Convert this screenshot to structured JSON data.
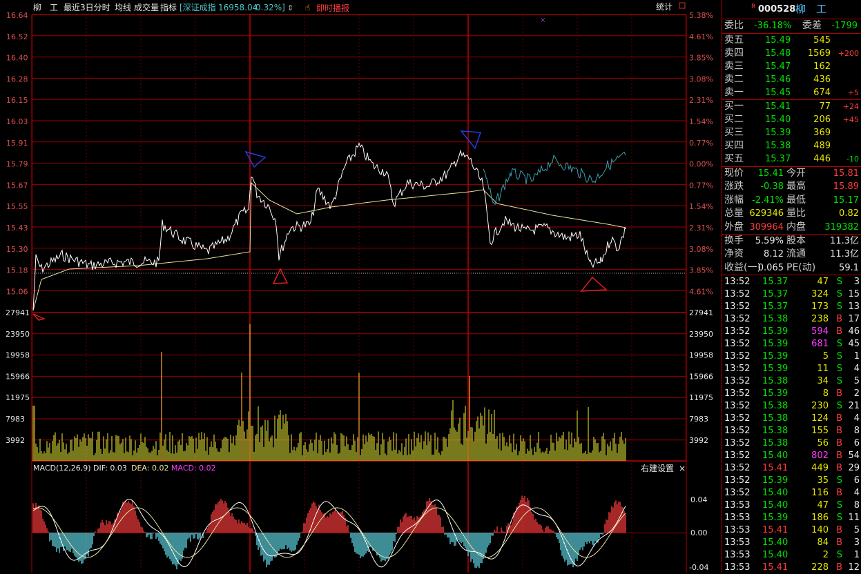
{
  "header": {
    "stock_name": "柳　工",
    "menu": [
      "最近3日分时",
      "均线",
      "成交量",
      "指标"
    ],
    "index_label": "[深证成指",
    "index_value": "16958.04",
    "index_change": "0.32%]",
    "live_label": "即时播报",
    "stats_label": "统计"
  },
  "price_axis": {
    "left": [
      "16.64",
      "16.52",
      "16.40",
      "16.28",
      "16.15",
      "16.03",
      "15.91",
      "15.79",
      "15.67",
      "15.55",
      "15.43",
      "15.30",
      "15.18",
      "15.06"
    ],
    "right": [
      "5.38%",
      "4.61%",
      "3.85%",
      "3.08%",
      "2.31%",
      "1.54%",
      "0.77%",
      "0.00%",
      "0.77%",
      "1.54%",
      "2.31%",
      "3.08%",
      "3.85%",
      "4.61%"
    ]
  },
  "volume_axis": [
    "27941",
    "23950",
    "19958",
    "15966",
    "11975",
    "7983",
    "3992"
  ],
  "macd": {
    "title": "MACD(12,26,9)",
    "dif_label": "DIF: 0.03",
    "dea_label": "DEA: 0.02",
    "macd_label": "MACD: 0.02",
    "right_label": "右建设置",
    "close": "×",
    "axis": [
      "0.04",
      "0.00",
      "-0.04"
    ]
  },
  "quote": {
    "badge": "R",
    "code": "000528",
    "name": "柳　工",
    "weibi_label": "委比",
    "weibi": "-36.18%",
    "weicha_label": "委差",
    "weicha": "-1799",
    "asks": [
      {
        "label": "卖五",
        "price": "15.49",
        "vol": "545",
        "chg": ""
      },
      {
        "label": "卖四",
        "price": "15.48",
        "vol": "1569",
        "chg": "+200"
      },
      {
        "label": "卖三",
        "price": "15.47",
        "vol": "162",
        "chg": ""
      },
      {
        "label": "卖二",
        "price": "15.46",
        "vol": "436",
        "chg": ""
      },
      {
        "label": "卖一",
        "price": "15.45",
        "vol": "674",
        "chg": "+5"
      }
    ],
    "bids": [
      {
        "label": "买一",
        "price": "15.41",
        "vol": "77",
        "chg": "+24"
      },
      {
        "label": "买二",
        "price": "15.40",
        "vol": "206",
        "chg": "+45"
      },
      {
        "label": "买三",
        "price": "15.39",
        "vol": "369",
        "chg": ""
      },
      {
        "label": "买四",
        "price": "15.38",
        "vol": "489",
        "chg": ""
      },
      {
        "label": "买五",
        "price": "15.37",
        "vol": "446",
        "chg": "-10"
      }
    ],
    "stats": [
      {
        "l1": "现价",
        "v1": "15.41",
        "c1": "grn",
        "l2": "今开",
        "v2": "15.81",
        "c2": "red"
      },
      {
        "l1": "涨跌",
        "v1": "-0.38",
        "c1": "grn",
        "l2": "最高",
        "v2": "15.89",
        "c2": "red"
      },
      {
        "l1": "涨幅",
        "v1": "-2.41%",
        "c1": "grn",
        "l2": "最低",
        "v2": "15.17",
        "c2": "grn"
      },
      {
        "l1": "总量",
        "v1": "629346",
        "c1": "yel",
        "l2": "量比",
        "v2": "0.82",
        "c2": "yel"
      },
      {
        "l1": "外盘",
        "v1": "309964",
        "c1": "red",
        "l2": "内盘",
        "v2": "319382",
        "c2": "grn"
      }
    ],
    "fund": [
      {
        "l1": "换手",
        "v1": "5.59%",
        "l2": "股本",
        "v2": "11.3亿"
      },
      {
        "l1": "净资",
        "v1": "8.12",
        "l2": "流通",
        "v2": "11.3亿"
      },
      {
        "l1": "收益(一)",
        "v1": "0.065",
        "l2": "PE(动)",
        "v2": "59.1"
      }
    ]
  },
  "trades": [
    {
      "t": "13:52",
      "p": "15.37",
      "v": "47",
      "s": "S",
      "n": "3",
      "vc": "yel"
    },
    {
      "t": "13:52",
      "p": "15.37",
      "v": "324",
      "s": "S",
      "n": "15",
      "vc": "yel"
    },
    {
      "t": "13:52",
      "p": "15.37",
      "v": "173",
      "s": "S",
      "n": "13",
      "vc": "yel"
    },
    {
      "t": "13:52",
      "p": "15.38",
      "v": "238",
      "s": "B",
      "n": "17",
      "vc": "yel"
    },
    {
      "t": "13:52",
      "p": "15.39",
      "v": "594",
      "s": "B",
      "n": "46",
      "vc": "mag"
    },
    {
      "t": "13:52",
      "p": "15.39",
      "v": "681",
      "s": "S",
      "n": "45",
      "vc": "mag"
    },
    {
      "t": "13:52",
      "p": "15.39",
      "v": "5",
      "s": "S",
      "n": "1",
      "vc": "yel"
    },
    {
      "t": "13:52",
      "p": "15.39",
      "v": "11",
      "s": "S",
      "n": "4",
      "vc": "yel"
    },
    {
      "t": "13:52",
      "p": "15.38",
      "v": "34",
      "s": "S",
      "n": "5",
      "vc": "yel"
    },
    {
      "t": "13:52",
      "p": "15.39",
      "v": "8",
      "s": "B",
      "n": "2",
      "vc": "yel"
    },
    {
      "t": "13:52",
      "p": "15.38",
      "v": "230",
      "s": "S",
      "n": "21",
      "vc": "yel"
    },
    {
      "t": "13:52",
      "p": "15.38",
      "v": "124",
      "s": "B",
      "n": "4",
      "vc": "yel"
    },
    {
      "t": "13:52",
      "p": "15.38",
      "v": "155",
      "s": "B",
      "n": "8",
      "vc": "yel"
    },
    {
      "t": "13:52",
      "p": "15.38",
      "v": "56",
      "s": "B",
      "n": "6",
      "vc": "yel"
    },
    {
      "t": "13:52",
      "p": "15.40",
      "v": "802",
      "s": "B",
      "n": "54",
      "vc": "mag"
    },
    {
      "t": "13:52",
      "p": "15.41",
      "v": "449",
      "s": "B",
      "n": "29",
      "vc": "yel"
    },
    {
      "t": "13:52",
      "p": "15.39",
      "v": "35",
      "s": "S",
      "n": "6",
      "vc": "yel"
    },
    {
      "t": "13:52",
      "p": "15.40",
      "v": "116",
      "s": "B",
      "n": "4",
      "vc": "yel"
    },
    {
      "t": "13:53",
      "p": "15.40",
      "v": "47",
      "s": "S",
      "n": "8",
      "vc": "yel"
    },
    {
      "t": "13:53",
      "p": "15.39",
      "v": "186",
      "s": "S",
      "n": "11",
      "vc": "yel"
    },
    {
      "t": "13:53",
      "p": "15.41",
      "v": "140",
      "s": "B",
      "n": "5",
      "vc": "yel"
    },
    {
      "t": "13:53",
      "p": "15.40",
      "v": "84",
      "s": "B",
      "n": "3",
      "vc": "yel"
    },
    {
      "t": "13:53",
      "p": "15.40",
      "v": "2",
      "s": "S",
      "n": "1",
      "vc": "yel"
    },
    {
      "t": "13:53",
      "p": "15.41",
      "v": "228",
      "s": "B",
      "n": "12",
      "vc": "yel"
    }
  ]
}
